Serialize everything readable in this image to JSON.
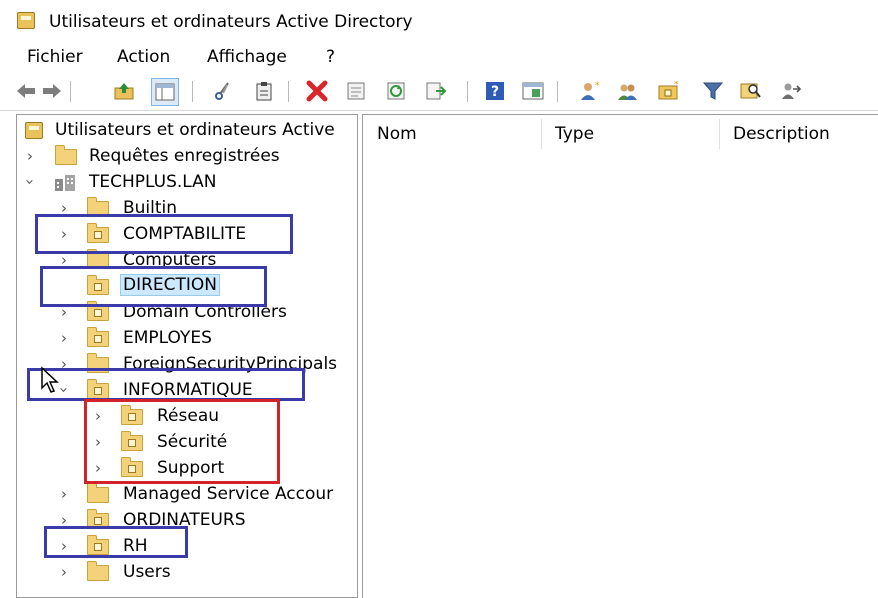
{
  "window": {
    "title": "Utilisateurs et ordinateurs Active Directory"
  },
  "menu": {
    "items": [
      "Fichier",
      "Action",
      "Affichage",
      "?"
    ]
  },
  "toolbar": {
    "icons": [
      "back-arrow-icon",
      "forward-arrow-icon",
      "up-folder-icon",
      "show-hide-tree-icon",
      "cut-icon",
      "paste-icon",
      "delete-icon",
      "properties-icon",
      "refresh-icon",
      "export-list-icon",
      "help-icon",
      "console-view-icon",
      "new-user-icon",
      "new-group-icon",
      "new-ou-icon",
      "filter-icon",
      "find-icon",
      "delegate-icon"
    ]
  },
  "tree": {
    "root": "Utilisateurs et ordinateurs Active",
    "saved_queries": "Requêtes enregistrées",
    "domain": "TECHPLUS.LAN",
    "items": [
      {
        "label": "Builtin",
        "type": "container"
      },
      {
        "label": "COMPTABILITE",
        "type": "ou"
      },
      {
        "label": "Computers",
        "type": "container"
      },
      {
        "label": "DIRECTION",
        "type": "ou",
        "selected": true
      },
      {
        "label": "Domain Controllers",
        "type": "ou"
      },
      {
        "label": "EMPLOYES",
        "type": "ou"
      },
      {
        "label": "ForeignSecurityPrincipals",
        "type": "container"
      },
      {
        "label": "INFORMATIQUE",
        "type": "ou",
        "expanded": true
      },
      {
        "label": "Réseau",
        "type": "ou",
        "level": 2
      },
      {
        "label": "Sécurité",
        "type": "ou",
        "level": 2
      },
      {
        "label": "Support",
        "type": "ou",
        "level": 2
      },
      {
        "label": "Managed Service Accour",
        "type": "container"
      },
      {
        "label": "ORDINATEURS",
        "type": "ou"
      },
      {
        "label": "RH",
        "type": "ou"
      },
      {
        "label": "Users",
        "type": "container"
      }
    ]
  },
  "list": {
    "columns": [
      "Nom",
      "Type",
      "Description"
    ]
  },
  "colors": {
    "highlight_blue": "#3a3aa8",
    "highlight_red": "#d2232a",
    "selection": "#cce8ff"
  }
}
